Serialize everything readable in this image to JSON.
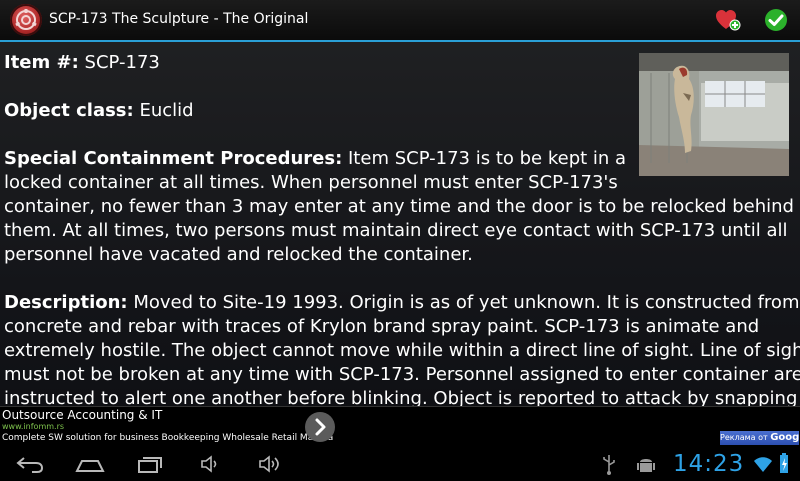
{
  "app": {
    "title": "SCP-173 The Sculpture - The Original"
  },
  "article": {
    "item_label": "Item #:",
    "item_value": "SCP-173",
    "class_label": "Object class:",
    "class_value": "Euclid",
    "procedures_label": "Special Containment Procedures:",
    "procedures_lines": [
      "Item SCP-173 is to be kept in a",
      "locked container at all times. When personnel must enter SCP-173's",
      "container, no fewer than 3 may enter at any time and the door is to be relocked behind",
      "them. At all times, two persons must maintain direct eye contact with SCP-173 until all",
      "personnel have vacated and relocked the container."
    ],
    "description_label": "Description:",
    "description_lines": [
      "Moved to Site-19 1993. Origin is as of yet unknown. It is constructed from",
      "concrete and rebar with traces of Krylon brand spray paint. SCP-173 is animate and",
      "extremely hostile. The object cannot move while within a direct line of sight. Line of sight",
      "must not be broken at any time with SCP-173. Personnel assigned to enter container are",
      "instructed to alert one another before blinking. Object is reported to attack by snapping the"
    ]
  },
  "ad": {
    "title": "Outsource Accounting & IT",
    "url": "www.infomm.rs",
    "description": "Complete SW solution for business Bookkeeping Wholesale Retail Manufa",
    "badge_prefix": "Реклама от",
    "badge_brand": "Google"
  },
  "status": {
    "time": "14:23"
  },
  "colors": {
    "accent": "#2a9fd6",
    "clock": "#2ea2e6",
    "ad_url": "#7ec34d",
    "ok": "#2bb12b",
    "fav": "#d9323a"
  }
}
